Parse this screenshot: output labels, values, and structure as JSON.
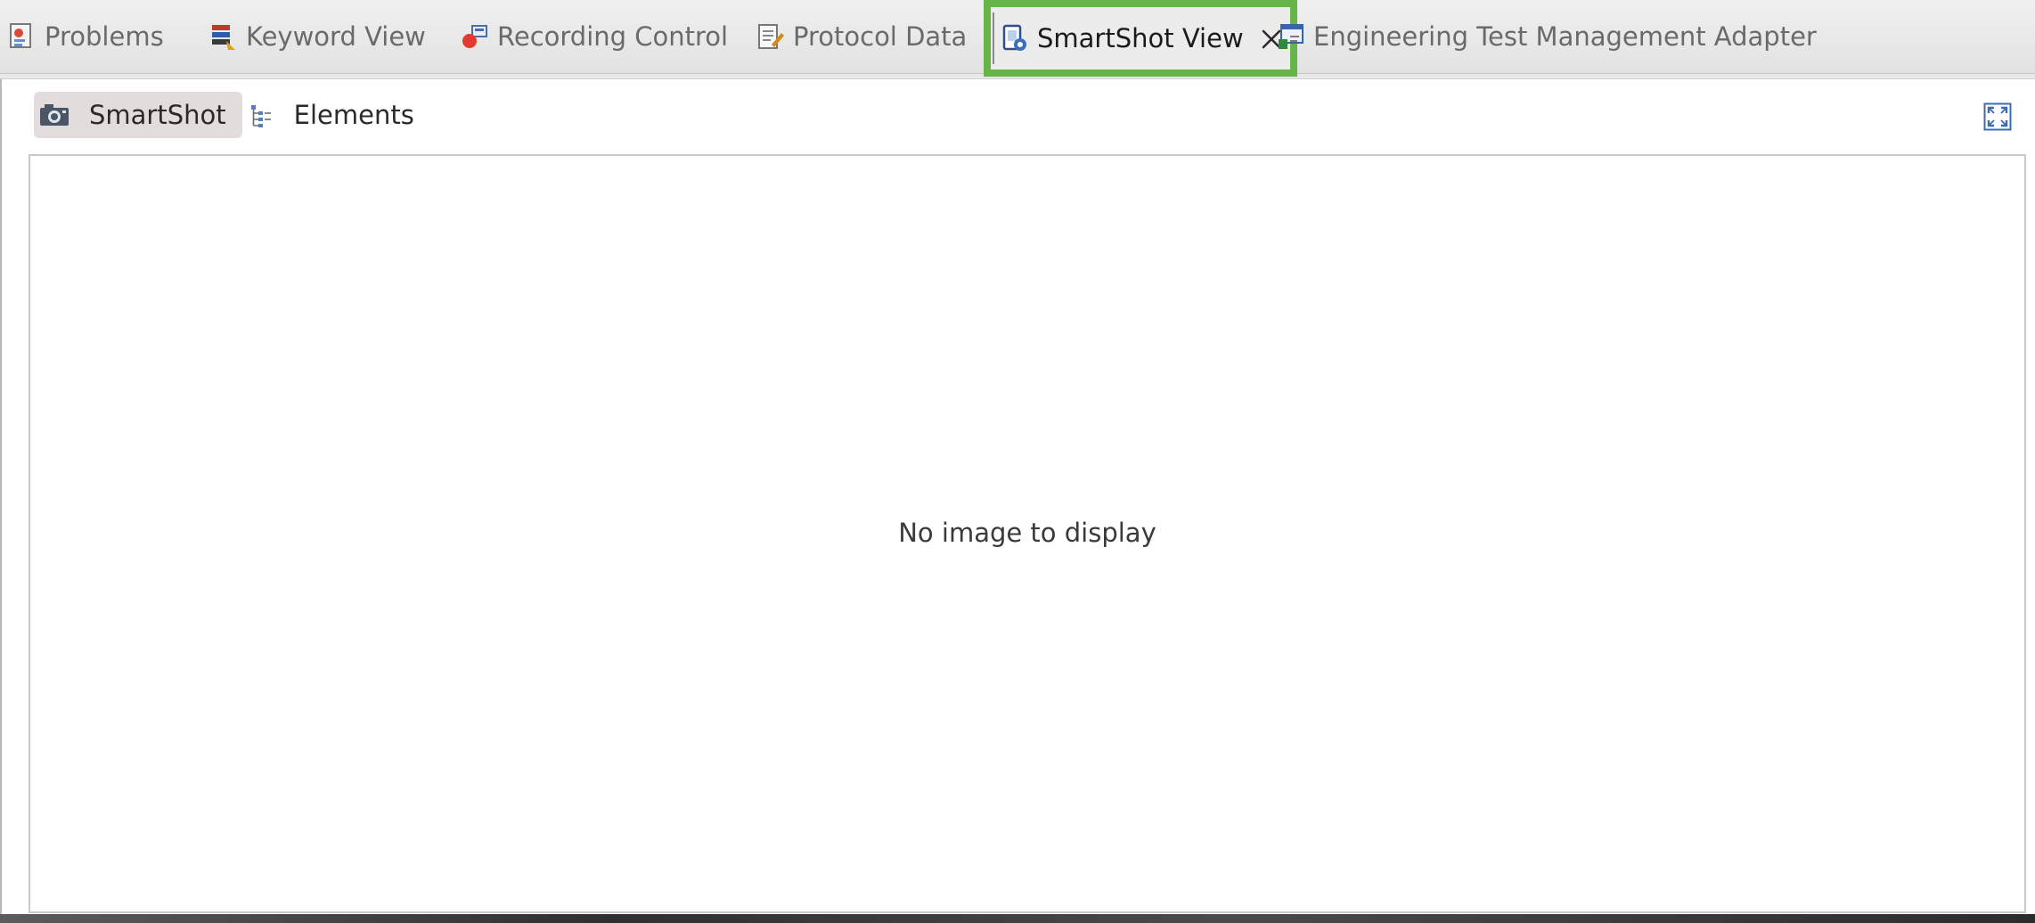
{
  "tabs": [
    {
      "label": "Problems",
      "icon": "problems-icon"
    },
    {
      "label": "Keyword View",
      "icon": "keyword-view-icon"
    },
    {
      "label": "Recording Control",
      "icon": "recording-control-icon"
    },
    {
      "label": "Protocol Data",
      "icon": "protocol-data-icon"
    },
    {
      "label": "SmartShot View",
      "icon": "smartshot-view-icon",
      "active": true
    },
    {
      "label": "Engineering Test Management Adapter",
      "icon": "etm-adapter-icon"
    }
  ],
  "highlight_color": "#67b548",
  "toolbar": {
    "smartshot_label": "SmartShot",
    "elements_label": "Elements"
  },
  "canvas": {
    "message": "No image to display"
  }
}
